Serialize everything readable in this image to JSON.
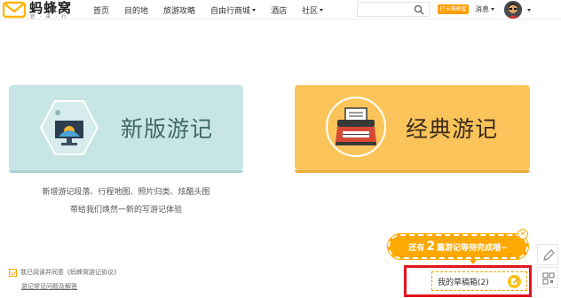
{
  "header": {
    "logo_text": "蚂蜂窝",
    "logo_sub": "自 · 由 · 行",
    "nav": [
      {
        "label": "首页",
        "dropdown": false
      },
      {
        "label": "目的地",
        "dropdown": false
      },
      {
        "label": "旅游攻略",
        "dropdown": false
      },
      {
        "label": "自由行商城",
        "dropdown": true
      },
      {
        "label": "酒店",
        "dropdown": false
      },
      {
        "label": "社区",
        "dropdown": true
      }
    ],
    "search_placeholder": "",
    "checkin_label": "打卡赚蜂蜜",
    "messages_label": "消息"
  },
  "cards": {
    "new_title": "新版游记",
    "classic_title": "经典游记"
  },
  "description": {
    "line1": "新增游记段落、行程地图、照片归类、炫酷头图",
    "line2": "带给我们焕然一新的写游记体验"
  },
  "footer": {
    "agree_text": "我已阅读并同意《蚂蜂窝游记协议》",
    "faq_link": "游记常见问题及解答"
  },
  "bubble": {
    "prefix": "还有",
    "count": "2",
    "suffix": "篇游记等待完成哦~",
    "close": "×"
  },
  "drafts": {
    "label": "我的草稿箱(2)"
  },
  "colors": {
    "accent": "#ffa800",
    "new_card": "#c8e5e6",
    "classic_card": "#fbc45a",
    "highlight": "#e0161d"
  }
}
